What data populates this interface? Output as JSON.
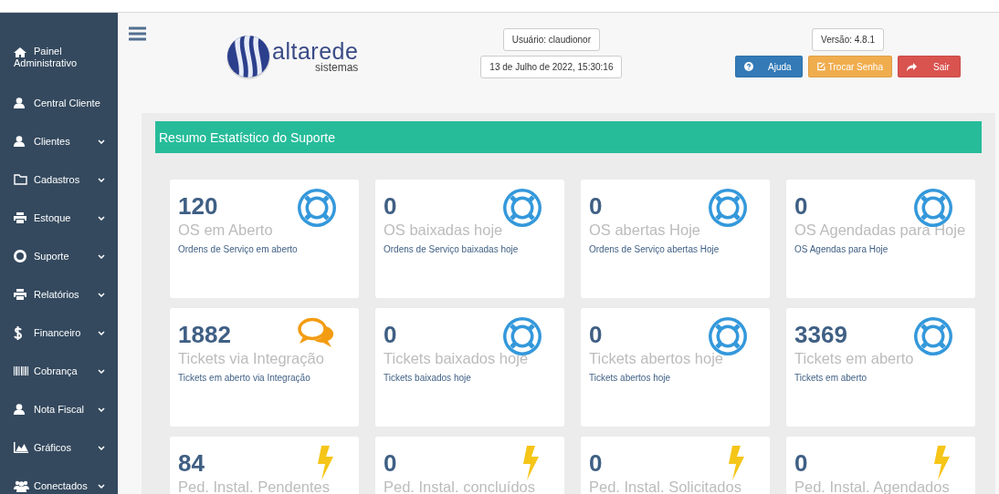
{
  "sidebar": {
    "items": [
      {
        "label": "Painel Administrativo",
        "kind": "link"
      },
      {
        "label": "Central Cliente",
        "kind": "link"
      },
      {
        "label": "Clientes",
        "kind": "menu"
      },
      {
        "label": "Cadastros",
        "kind": "menu"
      },
      {
        "label": "Estoque",
        "kind": "menu"
      },
      {
        "label": "Suporte",
        "kind": "menu"
      },
      {
        "label": "Relatórios",
        "kind": "menu"
      },
      {
        "label": "Financeiro",
        "kind": "menu"
      },
      {
        "label": "Cobrança",
        "kind": "menu"
      },
      {
        "label": "Nota Fiscal",
        "kind": "menu"
      },
      {
        "label": "Gráficos",
        "kind": "menu"
      },
      {
        "label": "Conectados",
        "kind": "menu"
      }
    ]
  },
  "header": {
    "logo": {
      "name": "altarede",
      "tagline": "sistemas"
    },
    "user": "Usuário: claudionor",
    "datetime": "13 de Julho de 2022, 15:30:16",
    "version": "Versão: 4.8.1",
    "buttons": [
      {
        "label": "Ajuda",
        "kind": "help"
      },
      {
        "label": "Trocar Senha",
        "kind": "edit"
      },
      {
        "label": "Sair",
        "kind": "exit"
      }
    ]
  },
  "panel": {
    "title": "Resumo Estatístico do Suporte",
    "cards": [
      {
        "value": "120",
        "title": "OS em Aberto",
        "subtitle": "Ordens de Serviço em aberto",
        "kind": "support"
      },
      {
        "value": "0",
        "title": "OS baixadas hoje",
        "subtitle": "Ordens de Serviço baixadas hoje",
        "kind": "support"
      },
      {
        "value": "0",
        "title": "OS abertas Hoje",
        "subtitle": "Ordens de Serviço abertas Hoje",
        "kind": "support"
      },
      {
        "value": "0",
        "title": "OS Agendadas para Hoje",
        "subtitle": "OS Agendas para Hoje",
        "kind": "support"
      },
      {
        "value": "1882",
        "title": "Tickets via Integração",
        "subtitle": "Tickets em aberto via Integração",
        "kind": "chat"
      },
      {
        "value": "0",
        "title": "Tickets baixados hoje",
        "subtitle": "Tickets baixados hoje",
        "kind": "support"
      },
      {
        "value": "0",
        "title": "Tickets abertos hoje",
        "subtitle": "Tickets abertos hoje",
        "kind": "support"
      },
      {
        "value": "3369",
        "title": "Tickets em aberto",
        "subtitle": "Tickets em aberto",
        "kind": "support"
      },
      {
        "value": "84",
        "title": "Ped. Instal. Pendentes",
        "kind": "bolt"
      },
      {
        "value": "0",
        "title": "Ped. Instal. concluídos",
        "kind": "bolt"
      },
      {
        "value": "0",
        "title": "Ped. Instal. Solicitados",
        "kind": "bolt"
      },
      {
        "value": "0",
        "title": "Ped. Instal. Agendados",
        "kind": "bolt"
      }
    ]
  }
}
